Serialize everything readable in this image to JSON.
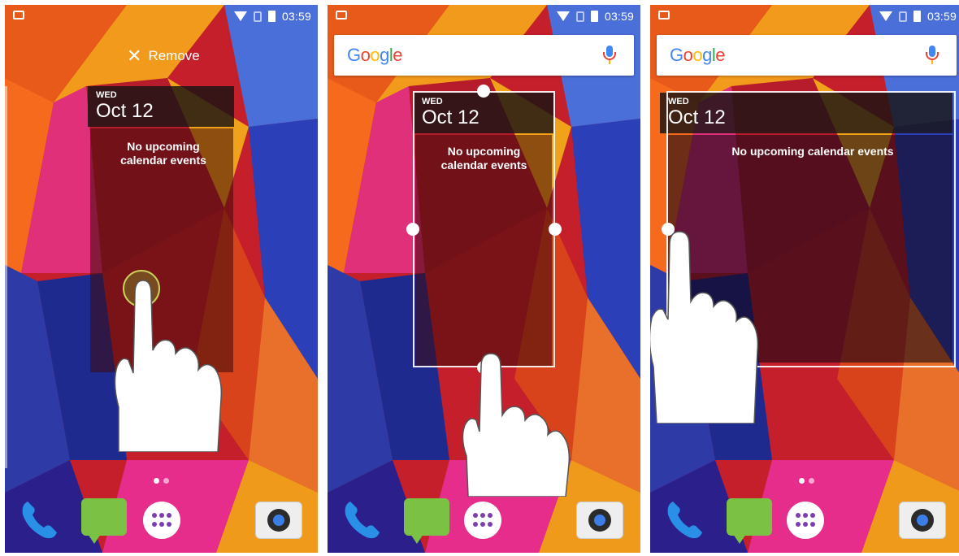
{
  "status_time": "03:59",
  "remove_label": "Remove",
  "google_logo": [
    "G",
    "o",
    "o",
    "g",
    "l",
    "e"
  ],
  "calendar": {
    "day": "WED",
    "date": "Oct 12",
    "message": "No upcoming calendar events"
  },
  "icons": [
    "phone-icon",
    "messaging-icon",
    "app-drawer-icon",
    "camera-icon",
    "wifi-icon",
    "battery-icon",
    "no-sim-icon",
    "mic-icon",
    "close-icon",
    "hand-pointer-icon"
  ],
  "page_indicator": {
    "pages": 2,
    "current": 1
  }
}
